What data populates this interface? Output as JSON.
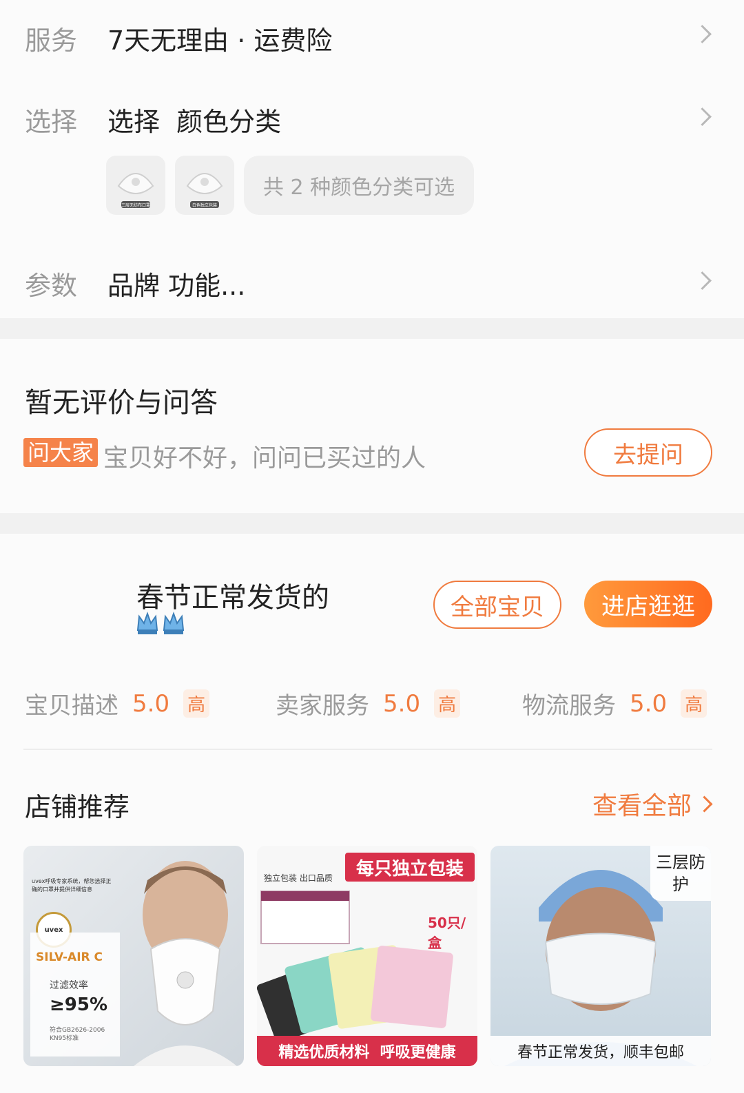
{
  "service": {
    "label": "服务",
    "value": "7天无理由 · 运费险"
  },
  "select": {
    "label": "选择",
    "value": "选择  颜色分类",
    "more_text": "共 2 种颜色分类可选",
    "thumb_captions": [
      "三层无纺布口罩",
      "白色独立包装"
    ]
  },
  "params": {
    "label": "参数",
    "value": "品牌 功能..."
  },
  "reviews": {
    "title": "暂无评价与问答",
    "ask_tag": "问大家",
    "ask_text": "宝贝好不好，问问已买过的人",
    "ask_button": "去提问"
  },
  "shop": {
    "name": "春节正常发货的",
    "badges": "👑👑",
    "all_items_button": "全部宝贝",
    "enter_button": "进店逛逛"
  },
  "scores": [
    {
      "label": "宝贝描述",
      "value": "5.0",
      "tag": "高"
    },
    {
      "label": "卖家服务",
      "value": "5.0",
      "tag": "高"
    },
    {
      "label": "物流服务",
      "value": "5.0",
      "tag": "高"
    }
  ],
  "recommend": {
    "title": "店铺推荐",
    "view_all": "查看全部",
    "items": [
      {
        "brand": "uvex",
        "intro": "uvex呼吸专家系统，帮您选择正确的口罩并提供详细信息",
        "product": "SILV-AIR C",
        "efficiency_label": "过滤效率",
        "efficiency": "≥95%",
        "standard": "符合GB2626-2006 KN95标准"
      },
      {
        "top_left": "独立包装 出口品质",
        "banner": "每只独立包装",
        "count": "50只/盒",
        "bottom": "精选优质材料  呼吸更健康"
      },
      {
        "corner": "三层防护",
        "bottom": "春节正常发货，顺丰包邮"
      }
    ]
  },
  "colors": {
    "accent": "#f07b3f",
    "gap": "#f1f1f1",
    "ask_tag_bg": "#f5834a"
  }
}
